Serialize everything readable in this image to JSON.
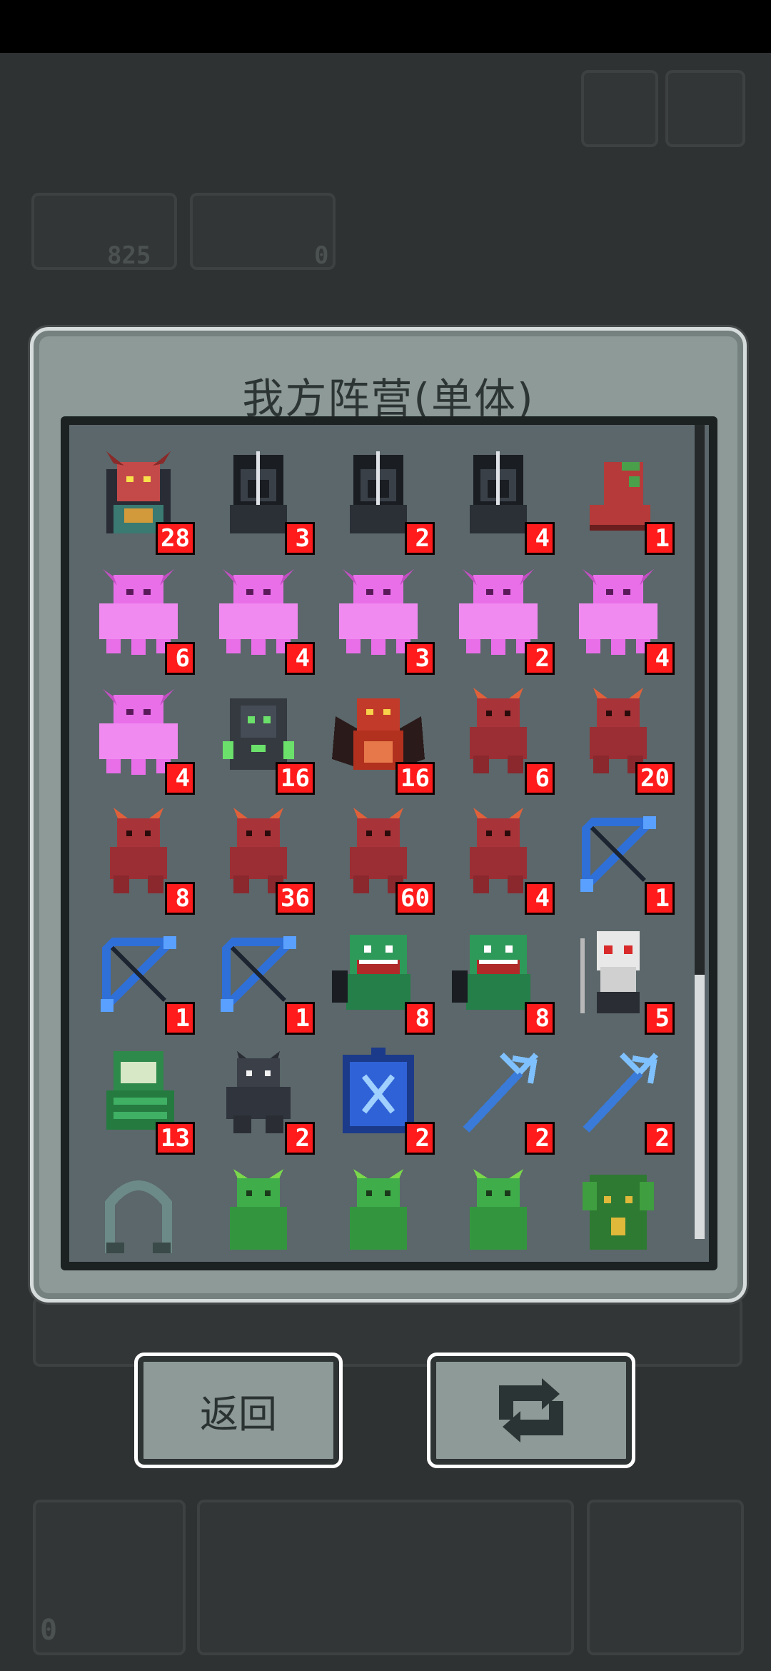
{
  "modal": {
    "title": "我方阵营(单体)",
    "units": [
      {
        "icon": "demon-lord-icon",
        "count": "28"
      },
      {
        "icon": "hooded-assassin-icon",
        "count": "3"
      },
      {
        "icon": "hooded-assassin-icon",
        "count": "2"
      },
      {
        "icon": "hooded-assassin-icon",
        "count": "4"
      },
      {
        "icon": "red-boot-icon",
        "count": "1"
      },
      {
        "icon": "pink-ghost-icon",
        "count": "6"
      },
      {
        "icon": "pink-ghost-icon",
        "count": "4"
      },
      {
        "icon": "pink-ghost-icon",
        "count": "3"
      },
      {
        "icon": "pink-ghost-icon",
        "count": "2"
      },
      {
        "icon": "pink-ghost-icon",
        "count": "4"
      },
      {
        "icon": "pink-ghost-icon",
        "count": "4"
      },
      {
        "icon": "shadow-golem-icon",
        "count": "16"
      },
      {
        "icon": "red-dragon-icon",
        "count": "16"
      },
      {
        "icon": "red-imp-icon",
        "count": "6"
      },
      {
        "icon": "red-imp-icon",
        "count": "20"
      },
      {
        "icon": "red-imp-icon",
        "count": "8"
      },
      {
        "icon": "red-imp-icon",
        "count": "36"
      },
      {
        "icon": "red-imp-icon",
        "count": "60"
      },
      {
        "icon": "red-imp-icon",
        "count": "4"
      },
      {
        "icon": "blue-bow-icon",
        "count": "1"
      },
      {
        "icon": "blue-bow-icon",
        "count": "1"
      },
      {
        "icon": "blue-bow-icon",
        "count": "1"
      },
      {
        "icon": "green-lizard-icon",
        "count": "8"
      },
      {
        "icon": "green-lizard-icon",
        "count": "8"
      },
      {
        "icon": "skull-shaman-icon",
        "count": "5"
      },
      {
        "icon": "green-serpent-icon",
        "count": "13"
      },
      {
        "icon": "dark-werewolf-icon",
        "count": "2"
      },
      {
        "icon": "blue-rune-icon",
        "count": "2"
      },
      {
        "icon": "ice-trident-icon",
        "count": "2"
      },
      {
        "icon": "ice-trident-icon",
        "count": "2"
      },
      {
        "icon": "stone-arch-icon",
        "count": ""
      },
      {
        "icon": "green-goblin-icon",
        "count": ""
      },
      {
        "icon": "green-goblin-icon",
        "count": ""
      },
      {
        "icon": "green-goblin-icon",
        "count": ""
      },
      {
        "icon": "treant-icon",
        "count": ""
      }
    ]
  },
  "buttons": {
    "back_label": "返回",
    "refresh_icon": "refresh-icon"
  },
  "background": {
    "counter_left": "825",
    "counter_right": "0",
    "counter_bottom": "0"
  },
  "colors": {
    "badge": "#ff1b1b",
    "panel": "#8d9a97",
    "grid_bg": "#5b676a"
  }
}
